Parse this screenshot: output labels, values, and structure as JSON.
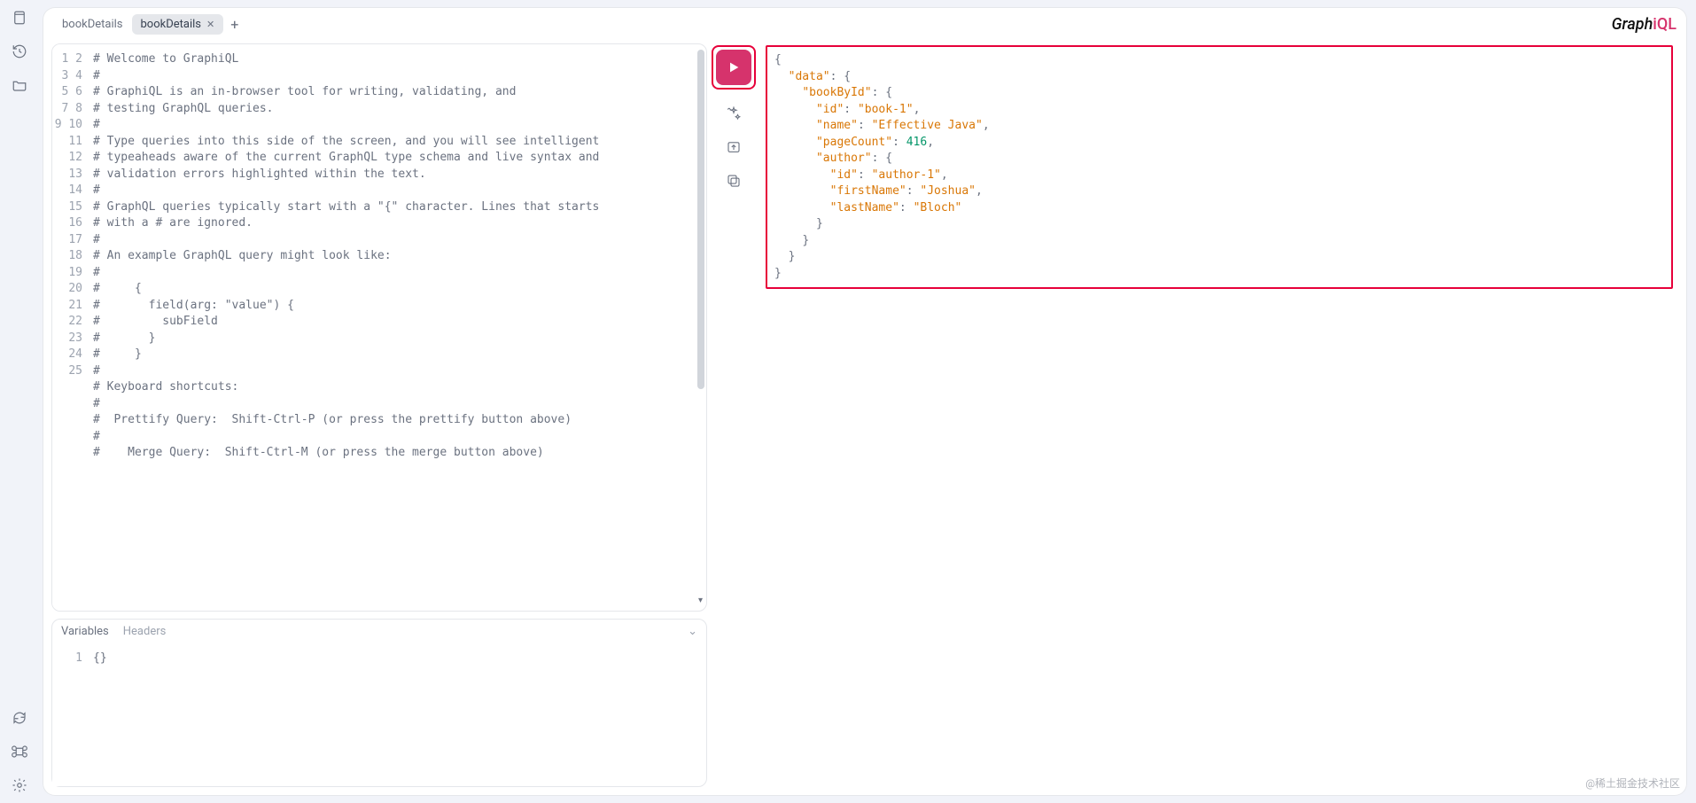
{
  "logo": {
    "part1": "Graph",
    "part2": "iQL"
  },
  "tabs": [
    {
      "label": "bookDetails",
      "active": false
    },
    {
      "label": "bookDetails",
      "active": true
    }
  ],
  "editor": {
    "lines": [
      "# Welcome to GraphiQL",
      "#",
      "# GraphiQL is an in-browser tool for writing, validating, and",
      "# testing GraphQL queries.",
      "#",
      "# Type queries into this side of the screen, and you will see intelligent",
      "# typeaheads aware of the current GraphQL type schema and live syntax and",
      "# validation errors highlighted within the text.",
      "#",
      "# GraphQL queries typically start with a \"{\" character. Lines that starts",
      "# with a # are ignored.",
      "#",
      "# An example GraphQL query might look like:",
      "#",
      "#     {",
      "#       field(arg: \"value\") {",
      "#         subField",
      "#       }",
      "#     }",
      "#",
      "# Keyboard shortcuts:",
      "#",
      "#  Prettify Query:  Shift-Ctrl-P (or press the prettify button above)",
      "#",
      "#    Merge Query:  Shift-Ctrl-M (or press the merge button above)"
    ],
    "visible_line_start": 1,
    "visible_line_end": 25
  },
  "vars_panel": {
    "tabs": {
      "variables": "Variables",
      "headers": "Headers"
    },
    "content": "{}",
    "line_no": "1"
  },
  "result": {
    "data": {
      "bookById": {
        "id": "book-1",
        "name": "Effective Java",
        "pageCount": 416,
        "author": {
          "id": "author-1",
          "firstName": "Joshua",
          "lastName": "Bloch"
        }
      }
    }
  },
  "watermark": "@稀土掘金技术社区"
}
